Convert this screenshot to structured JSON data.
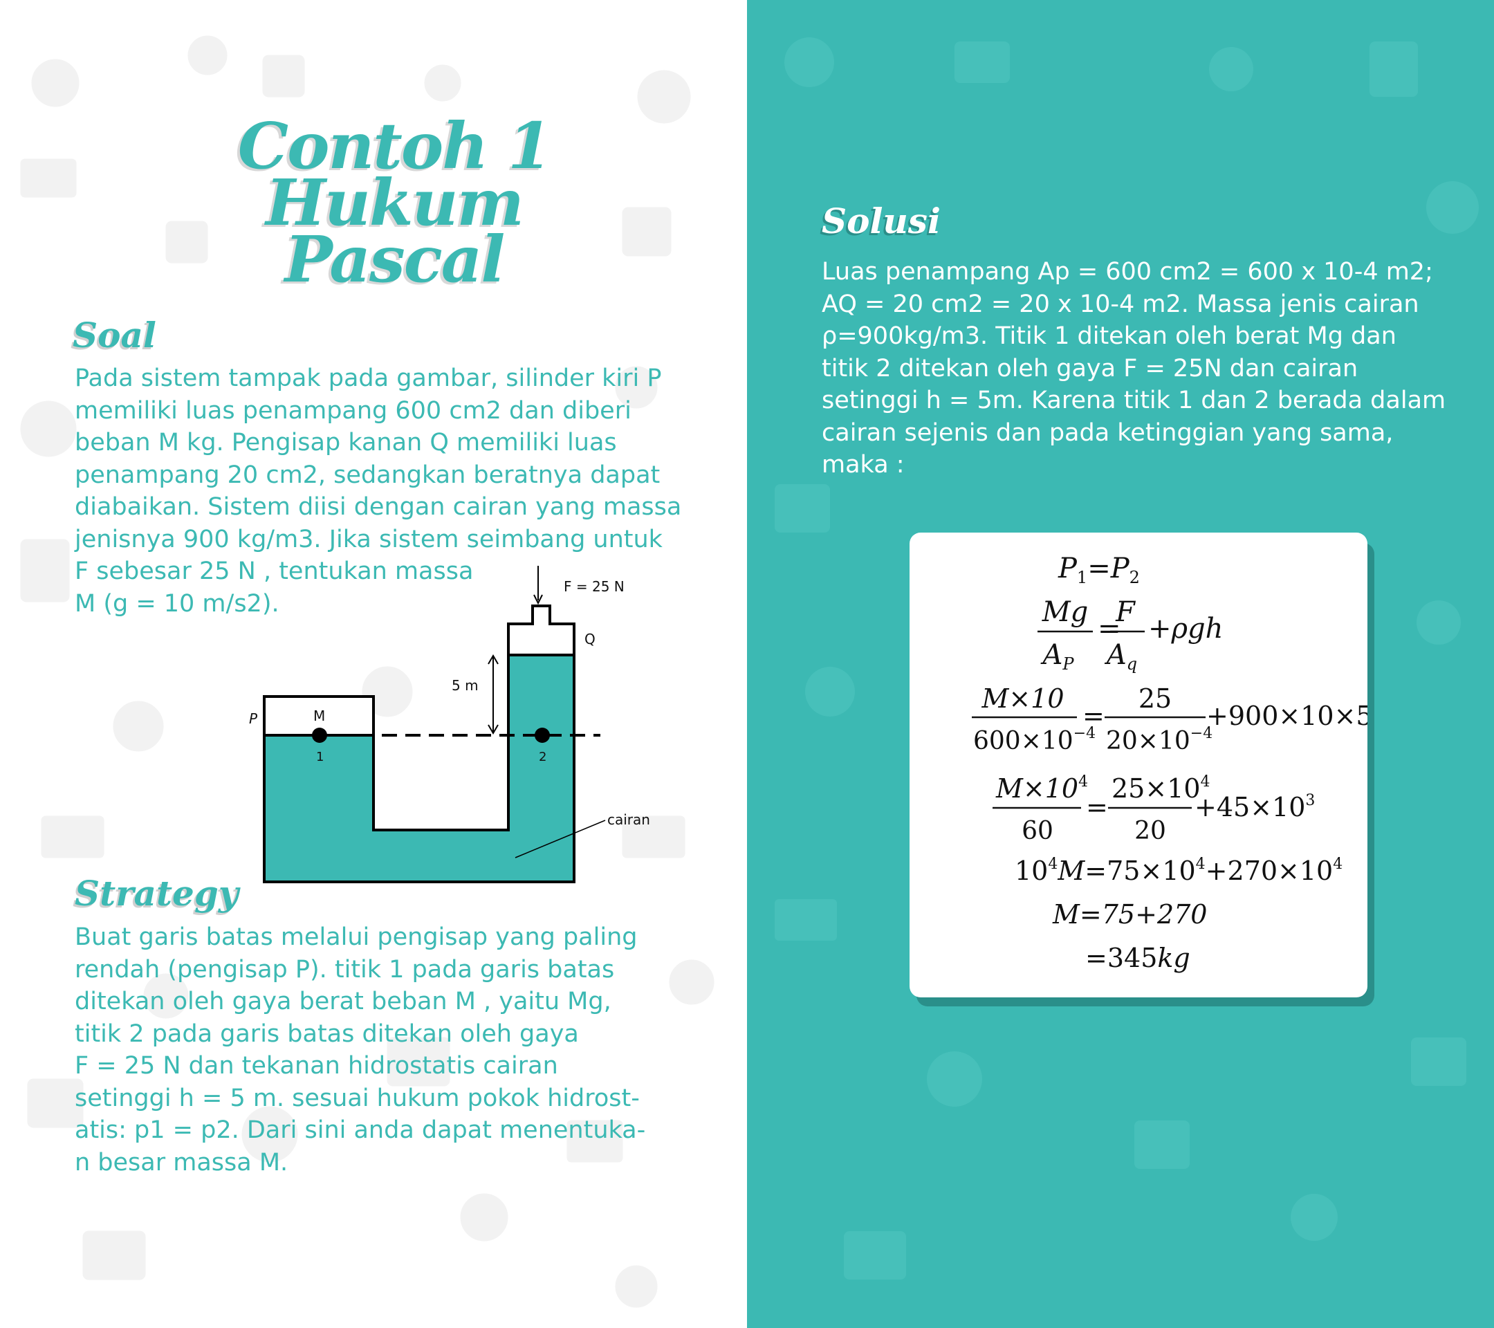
{
  "left": {
    "title_lines": [
      "Contoh 1",
      "Hukum",
      "Pascal"
    ],
    "soal": {
      "heading": "Soal",
      "lines": [
        "Pada sistem tampak pada  gambar, silinder kiri P",
        "memiliki  luas   penampang   600 cm2  dan  diberi",
        "beban  M   kg.   Pengisap kanan  Q  memiliki  luas",
        "penampang    20 cm2,  sedangkan beratnya dapat",
        "diabaikan. Sistem diisi dengan cairan yang massa",
        "jenisnya 900 kg/m3. Jika sistem seimbang untuk",
        "F sebesar    25 N , tentukan massa",
        "M (g = 10 m/s2)."
      ]
    },
    "diagram": {
      "force_label": "F = 25 N",
      "q_label": "Q",
      "height_label": "5 m",
      "p_label": "P",
      "m_label": "M",
      "point1_label": "1",
      "point2_label": "2",
      "fluid_label": "cairan",
      "fluid_color": "#3cb9b3"
    },
    "strategy": {
      "heading": "Strategy",
      "lines": [
        "Buat garis batas melalui pengisap yang paling",
        "rendah  (pengisap P). titik 1 pada garis batas",
        "ditekan oleh  gaya  berat beban M , yaitu Mg,",
        "titik 2  pada  garis  batas  ditekan  oleh gaya",
        "F = 25 N    dan  tekanan    hidrostatis   cairan",
        "setinggi h = 5 m. sesuai hukum pokok hidrost-",
        "atis: p1 = p2. Dari sini anda dapat menentuka-",
        "n besar massa M."
      ]
    }
  },
  "right": {
    "solusi": {
      "heading": "Solusi",
      "lines": [
        "Luas penampang    Ap = 600 cm2  = 600 x 10-4 m2;",
        "AQ = 20 cm2 = 20 x 10-4 m2.   Massa jenis cairan",
        "ρ=900kg/m3. Titik 1  ditekan  oleh  berat  Mg dan",
        "titik 2  ditekan  oleh   gaya    F = 25N  dan  cairan",
        "setinggi h = 5m. Karena titik 1 dan 2 berada dalam",
        "cairan sejenis dan pada ketinggian yang sama,",
        "maka :"
      ]
    },
    "formula": {
      "l1": {
        "lhs": "P",
        "lhs_sub": "1",
        "eq": "=",
        "rhs": "P",
        "rhs_sub": "2"
      },
      "l2": {
        "n1": "Mg",
        "d1": "A",
        "d1_sub": "P",
        "eq": "=",
        "n2": "F",
        "d2": "A",
        "d2_sub": "q",
        "tail": "+ρgh"
      },
      "l3": {
        "n1": "M×10",
        "d1": "600×10",
        "d1_sup": "−4",
        "eq": "=",
        "n2": "25",
        "d2": "20×10",
        "d2_sup": "−4",
        "tail": "+900×10×5"
      },
      "l4": {
        "n1": "M×10",
        "n1_sup": "4",
        "d1": "60",
        "eq": "=",
        "n2": "25×10",
        "n2_sup": "4",
        "d2": "20",
        "tail": "+45×10",
        "tail_sup": "3"
      },
      "l5": {
        "a": "10",
        "a_sup": "4",
        "b": "M",
        "c": "=75×10",
        "c_sup": "4",
        "d": "+270×10",
        "d_sup": "4"
      },
      "l6": {
        "text": "M=75+270"
      },
      "l7": {
        "text": "=345",
        "unit": "kg"
      }
    }
  },
  "colors": {
    "teal": "#3cb9b3",
    "teal_dark": "#2a8f8a",
    "white": "#ffffff"
  }
}
